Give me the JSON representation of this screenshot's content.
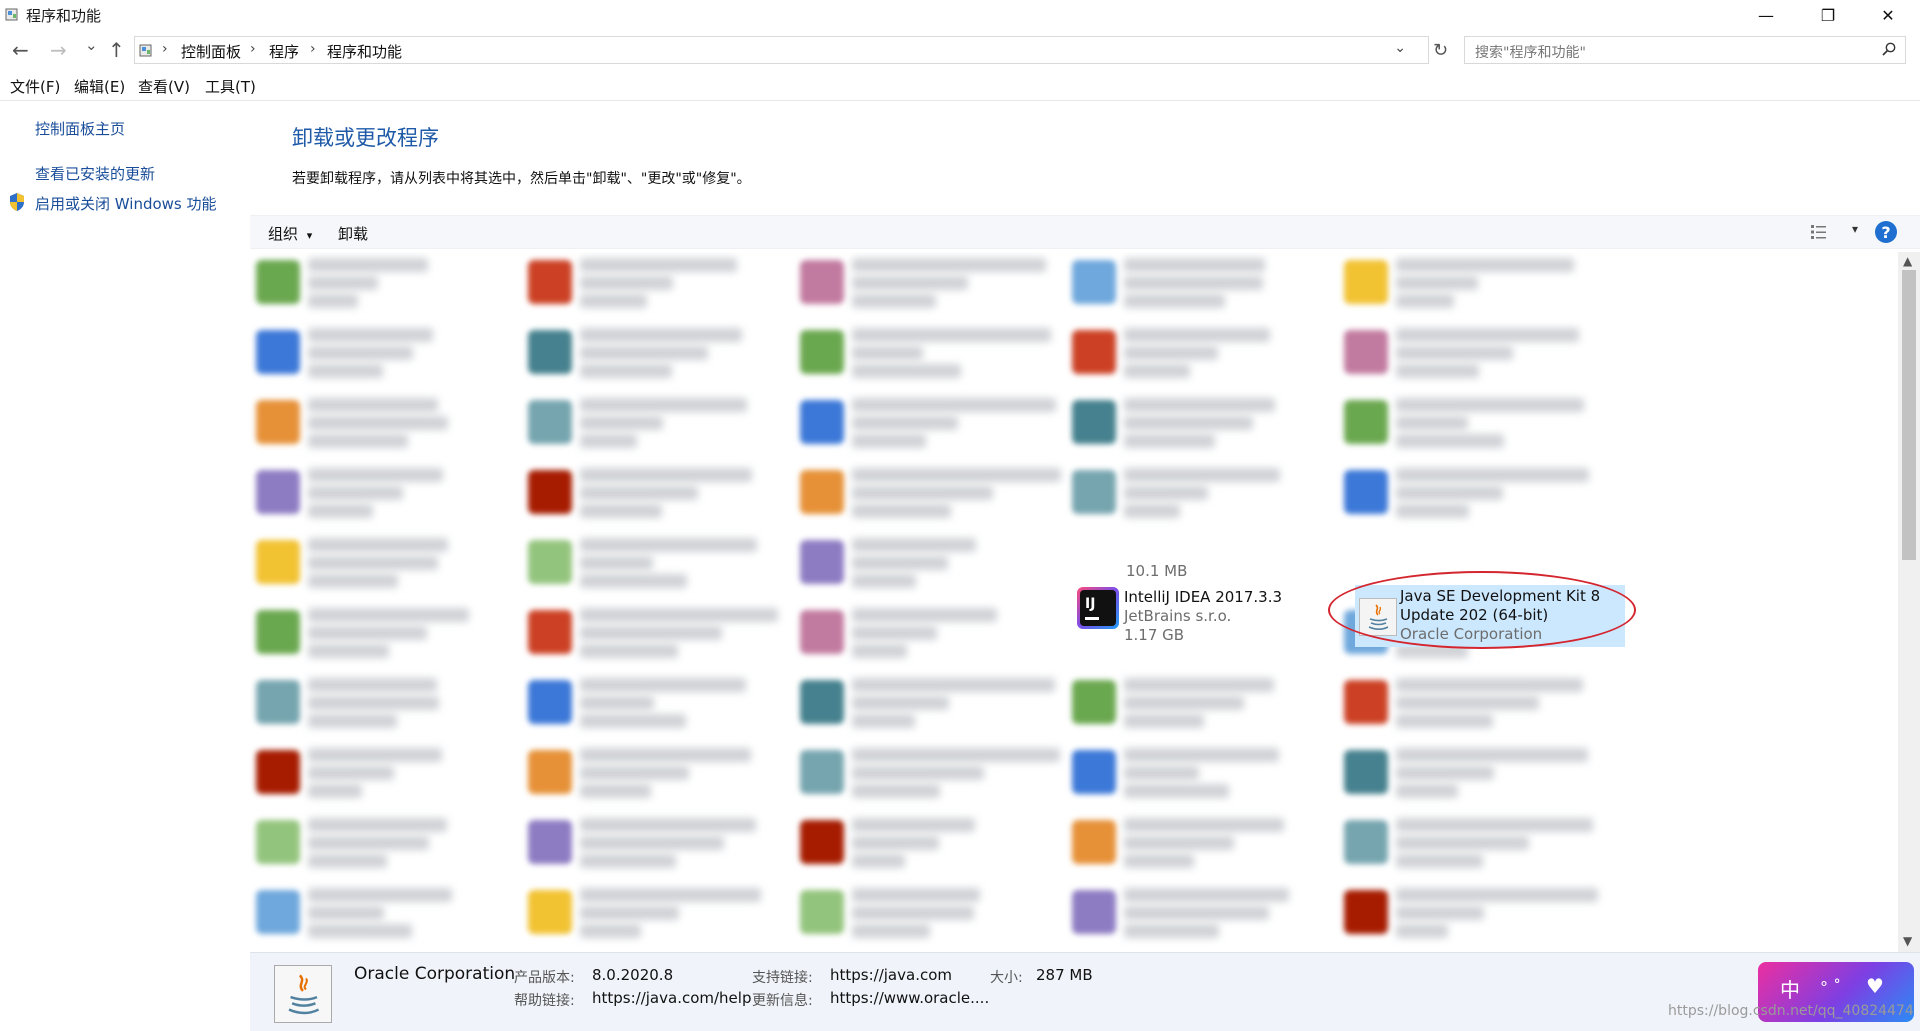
{
  "window": {
    "title": "程序和功能",
    "minimize_glyph": "—",
    "maximize_glyph": "❐",
    "close_glyph": "✕"
  },
  "nav": {
    "back_glyph": "←",
    "forward_glyph": "→",
    "recent_glyph": "⌄",
    "up_glyph": "↑",
    "breadcrumbs": [
      "控制面板",
      "程序",
      "程序和功能"
    ],
    "separator": "›",
    "dropdown_glyph": "⌄",
    "refresh_glyph": "↻",
    "search_placeholder": "搜索\"程序和功能\""
  },
  "menu": [
    "文件(F)",
    "编辑(E)",
    "查看(V)",
    "工具(T)"
  ],
  "sidebar": {
    "home": "控制面板主页",
    "updates": "查看已安装的更新",
    "features": "启用或关闭 Windows 功能"
  },
  "main": {
    "heading": "卸载或更改程序",
    "description": "若要卸载程序，请从列表中将其选中，然后单击\"卸载\"、\"更改\"或\"修复\"。"
  },
  "toolbar": {
    "organize": "组织",
    "organize_arrow": "▾",
    "uninstall": "卸载",
    "view_arrow": "▾",
    "help": "?"
  },
  "programs": {
    "partial_size": "10.1 MB",
    "intellij": {
      "name": "IntelliJ IDEA 2017.3.3",
      "publisher": "JetBrains s.r.o.",
      "size": "1.17 GB",
      "icon_text": "IJ"
    },
    "jdk": {
      "name_line1": "Java SE Development Kit 8",
      "name_line2": "Update 202 (64-bit)",
      "publisher": "Oracle Corporation"
    }
  },
  "details": {
    "publisher": "Oracle Corporation",
    "product_version_label": "产品版本:",
    "product_version": "8.0.2020.8",
    "support_link_label": "支持链接:",
    "support_link": "https://java.com",
    "size_label": "大小:",
    "size": "287 MB",
    "help_link_label": "帮助链接:",
    "help_link": "https://java.com/help",
    "update_info_label": "更新信息:",
    "update_info": "https://www.oracle...."
  },
  "ime": {
    "label": "中"
  },
  "watermark": "https://blog.csdn.net/qq_40824474",
  "colors": {
    "link": "#1a4e9a",
    "heading": "#1e5aa8",
    "selection": "#cce8ff",
    "highlight_ring": "#d4262f"
  }
}
